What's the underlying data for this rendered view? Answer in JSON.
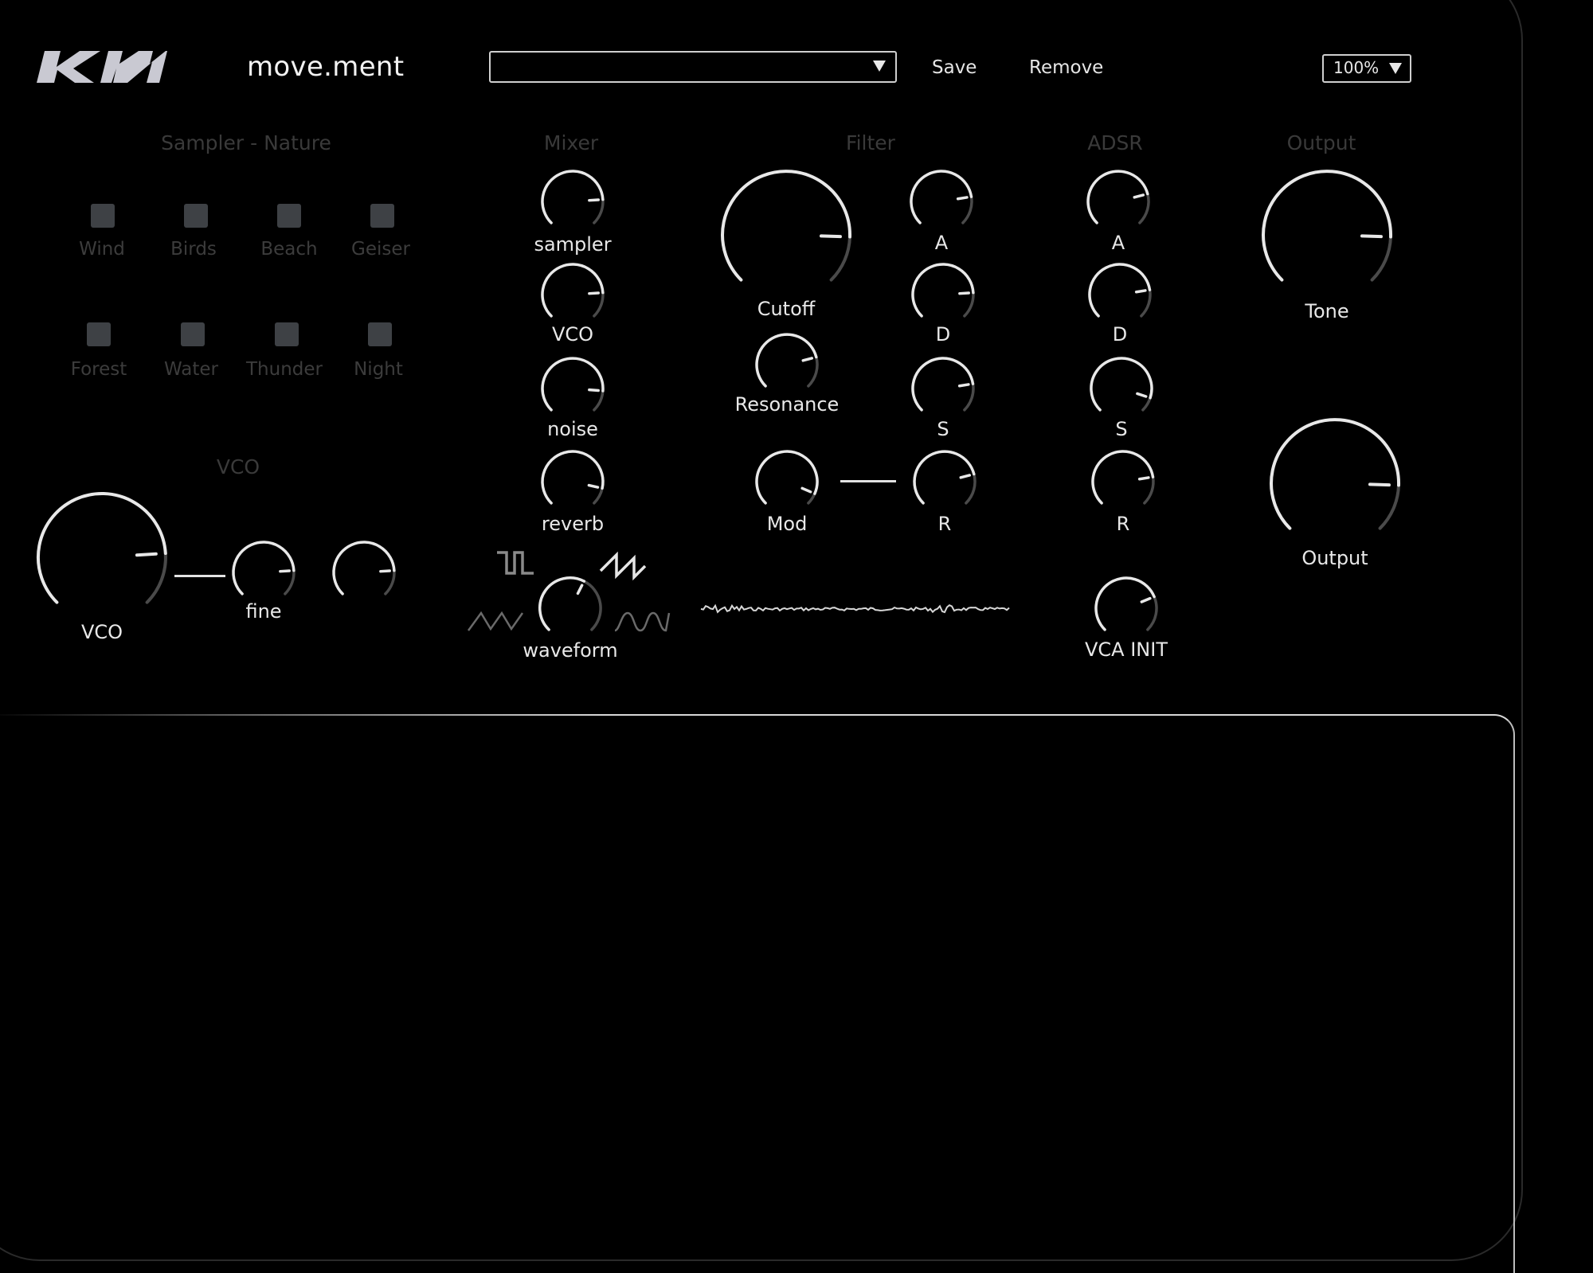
{
  "header": {
    "brand": "KIA",
    "app_title": "move.ment",
    "preset_select": {
      "value": ""
    },
    "save_label": "Save",
    "remove_label": "Remove",
    "zoom_select": {
      "value": "100%"
    }
  },
  "sections": {
    "sampler": "Sampler - Nature",
    "mixer": "Mixer",
    "filter": "Filter",
    "adsr": "ADSR",
    "output": "Output",
    "vco": "VCO"
  },
  "sampler": {
    "pads": [
      {
        "label": "Wind",
        "active": false
      },
      {
        "label": "Birds",
        "active": false
      },
      {
        "label": "Beach",
        "active": false
      },
      {
        "label": "Geiser",
        "active": false
      },
      {
        "label": "Forest",
        "active": false
      },
      {
        "label": "Water",
        "active": false
      },
      {
        "label": "Thunder",
        "active": false
      },
      {
        "label": "Night",
        "active": false
      }
    ]
  },
  "knobs": {
    "vco": {
      "label": "VCO",
      "value": 0.82
    },
    "fine": {
      "label": "fine",
      "value": 0.82
    },
    "vco_extra": {
      "label": "",
      "value": 0.82
    },
    "mix_sampler": {
      "label": "sampler",
      "value": 0.82
    },
    "mix_vco": {
      "label": "VCO",
      "value": 0.82
    },
    "mix_noise": {
      "label": "noise",
      "value": 0.85
    },
    "mix_reverb": {
      "label": "reverb",
      "value": 0.88
    },
    "waveform": {
      "label": "waveform",
      "value": 0.6
    },
    "cutoff": {
      "label": "Cutoff",
      "value": 0.84
    },
    "resonance": {
      "label": "Resonance",
      "value": 0.78
    },
    "mod": {
      "label": "Mod",
      "value": 0.92
    },
    "filter_a": {
      "label": "A",
      "value": 0.8
    },
    "filter_d": {
      "label": "D",
      "value": 0.82
    },
    "filter_s": {
      "label": "S",
      "value": 0.8
    },
    "filter_r": {
      "label": "R",
      "value": 0.78
    },
    "adsr_a": {
      "label": "A",
      "value": 0.78
    },
    "adsr_d": {
      "label": "D",
      "value": 0.8
    },
    "adsr_s": {
      "label": "S",
      "value": 0.9
    },
    "adsr_r": {
      "label": "R",
      "value": 0.8
    },
    "vca_init": {
      "label": "VCA INIT",
      "value": 0.75
    },
    "tone": {
      "label": "Tone",
      "value": 0.84
    },
    "output": {
      "label": "Output",
      "value": 0.84
    }
  },
  "waveforms": [
    {
      "name": "square",
      "selected": false
    },
    {
      "name": "sawtooth",
      "selected": true
    },
    {
      "name": "triangle",
      "selected": false
    },
    {
      "name": "sine",
      "selected": false
    }
  ],
  "colors": {
    "background": "#000000",
    "knob_active": "#e8e8e8",
    "knob_inactive": "#4a4a4a",
    "section_title": "#3a3a3a",
    "pad": "#3e4145"
  }
}
